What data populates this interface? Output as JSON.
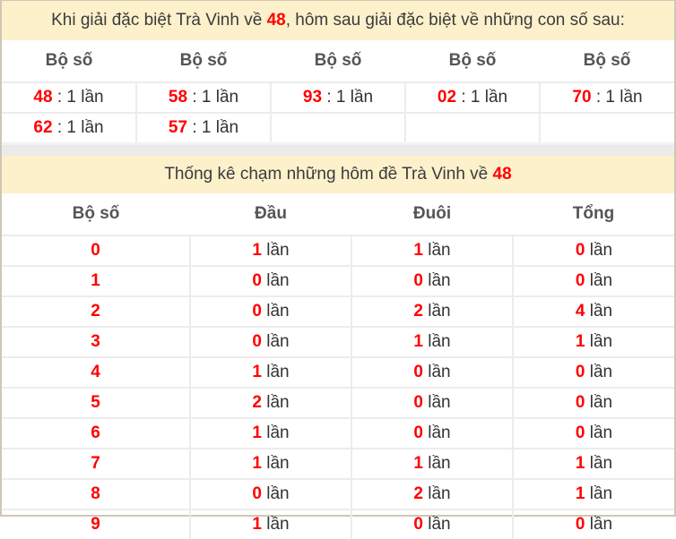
{
  "colors": {
    "accent": "#ff0000",
    "banner_bg": "#fdf1cc",
    "border": "#cfc6b6"
  },
  "section1": {
    "banner_prefix": "Khi giải đặc biệt Trà Vinh về ",
    "banner_number": "48",
    "banner_suffix": ", hôm sau giải đặc biệt về những con số sau:",
    "headers": [
      "Bộ số",
      "Bộ số",
      "Bộ số",
      "Bộ số",
      "Bộ số"
    ],
    "rows": [
      [
        {
          "num": "48",
          "text": " : 1 lần"
        },
        {
          "num": "58",
          "text": " : 1 lần"
        },
        {
          "num": "93",
          "text": " : 1 lần"
        },
        {
          "num": "02",
          "text": " : 1 lần"
        },
        {
          "num": "70",
          "text": " : 1 lần"
        }
      ],
      [
        {
          "num": "62",
          "text": " : 1 lần"
        },
        {
          "num": "57",
          "text": " : 1 lần"
        },
        {
          "num": "",
          "text": ""
        },
        {
          "num": "",
          "text": ""
        },
        {
          "num": "",
          "text": ""
        }
      ]
    ]
  },
  "section2": {
    "banner_prefix": "Thống kê chạm những hôm đề Trà Vinh về ",
    "banner_number": "48",
    "headers": [
      "Bộ số",
      "Đầu",
      "Đuôi",
      "Tổng"
    ],
    "unit": " lần",
    "rows": [
      {
        "bo_so": "0",
        "dau": "1",
        "duoi": "1",
        "tong": "0"
      },
      {
        "bo_so": "1",
        "dau": "0",
        "duoi": "0",
        "tong": "0"
      },
      {
        "bo_so": "2",
        "dau": "0",
        "duoi": "2",
        "tong": "4"
      },
      {
        "bo_so": "3",
        "dau": "0",
        "duoi": "1",
        "tong": "1"
      },
      {
        "bo_so": "4",
        "dau": "1",
        "duoi": "0",
        "tong": "0"
      },
      {
        "bo_so": "5",
        "dau": "2",
        "duoi": "0",
        "tong": "0"
      },
      {
        "bo_so": "6",
        "dau": "1",
        "duoi": "0",
        "tong": "0"
      },
      {
        "bo_so": "7",
        "dau": "1",
        "duoi": "1",
        "tong": "1"
      },
      {
        "bo_so": "8",
        "dau": "0",
        "duoi": "2",
        "tong": "1"
      },
      {
        "bo_so": "9",
        "dau": "1",
        "duoi": "0",
        "tong": "0"
      }
    ]
  }
}
